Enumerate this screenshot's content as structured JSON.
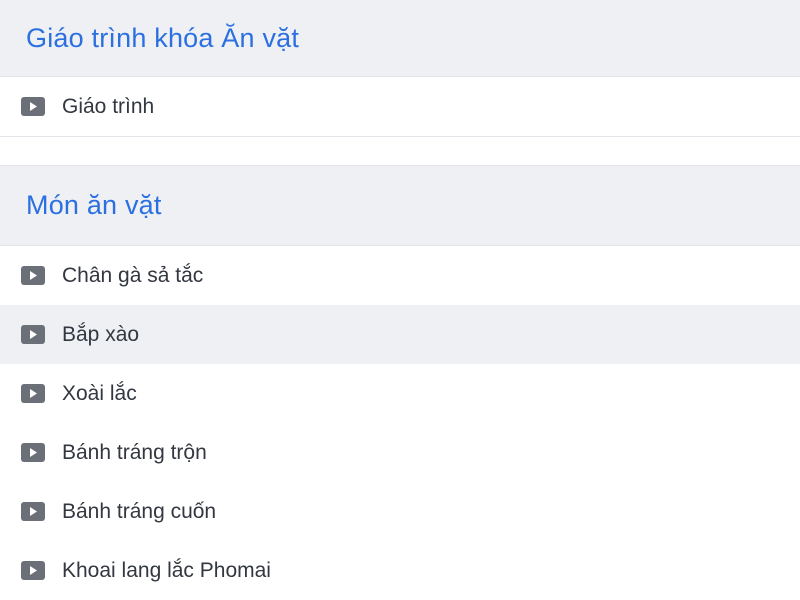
{
  "sections": [
    {
      "title": "Giáo trình khóa Ăn vặt",
      "lessons": [
        {
          "label": "Giáo trình",
          "icon": "play-icon"
        }
      ]
    },
    {
      "title": "Món ăn vặt",
      "lessons": [
        {
          "label": "Chân gà sả tắc",
          "icon": "play-icon"
        },
        {
          "label": "Bắp xào",
          "icon": "play-icon",
          "active": true
        },
        {
          "label": "Xoài lắc",
          "icon": "play-icon"
        },
        {
          "label": "Bánh tráng trộn",
          "icon": "play-icon"
        },
        {
          "label": "Bánh tráng cuốn",
          "icon": "play-icon"
        },
        {
          "label": "Khoai lang lắc Phomai",
          "icon": "play-icon"
        }
      ]
    }
  ],
  "colors": {
    "accent": "#2b6fe0",
    "header_bg": "#eef0f4",
    "icon": "#6b6f78",
    "text": "#333740"
  }
}
